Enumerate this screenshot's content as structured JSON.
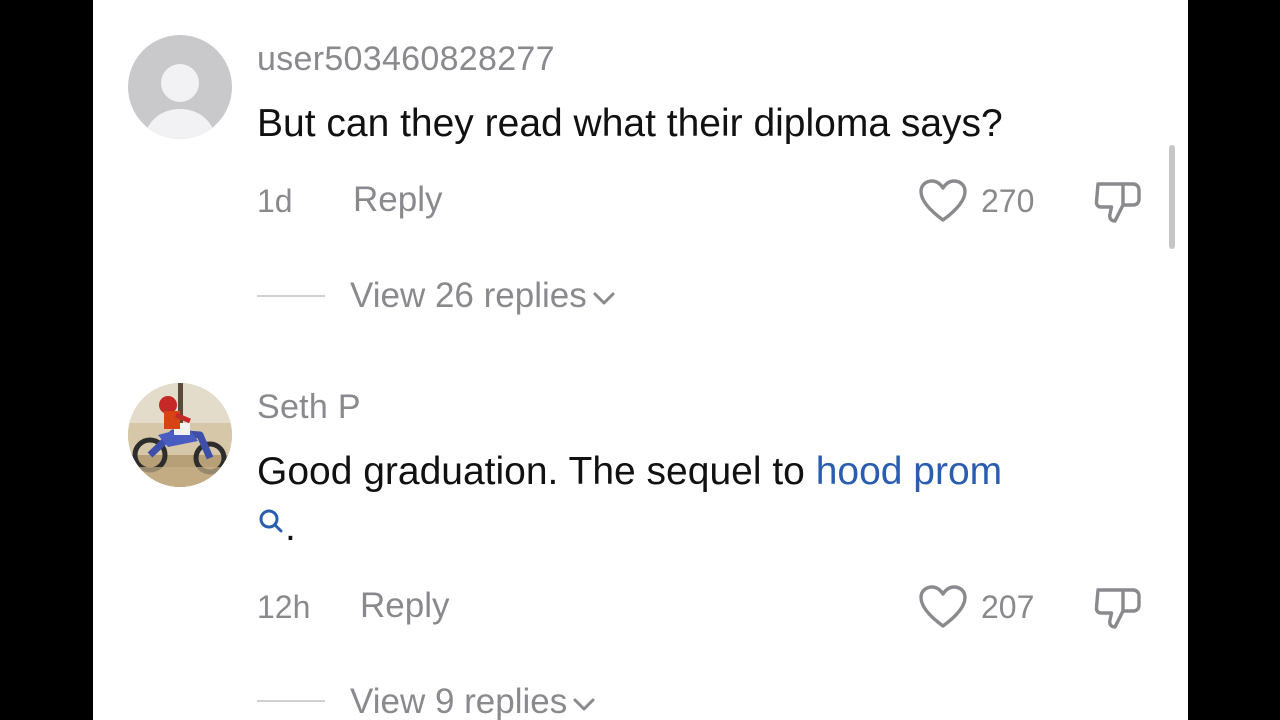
{
  "comments": [
    {
      "username": "user503460828277",
      "text": "But can they read what their diploma says?",
      "time": "1d",
      "reply_label": "Reply",
      "likes": "270",
      "view_replies": "View 26 replies"
    },
    {
      "username": "Seth  P",
      "text_prefix": "Good graduation. The sequel to ",
      "text_link": "hood prom",
      "text_suffix": ".",
      "time": "12h",
      "reply_label": "Reply",
      "likes": "207",
      "view_replies": "View 9 replies"
    }
  ],
  "icons": {
    "like": "heart-outline-icon",
    "dislike": "thumbs-down-icon",
    "search": "search-icon",
    "chevron": "chevron-down-icon"
  },
  "colors": {
    "background": "#000000",
    "surface": "#ffffff",
    "primary_text": "#111111",
    "secondary_text": "#8a8a8e",
    "link": "#2a5db0",
    "default_avatar": "#c9c9cc"
  }
}
